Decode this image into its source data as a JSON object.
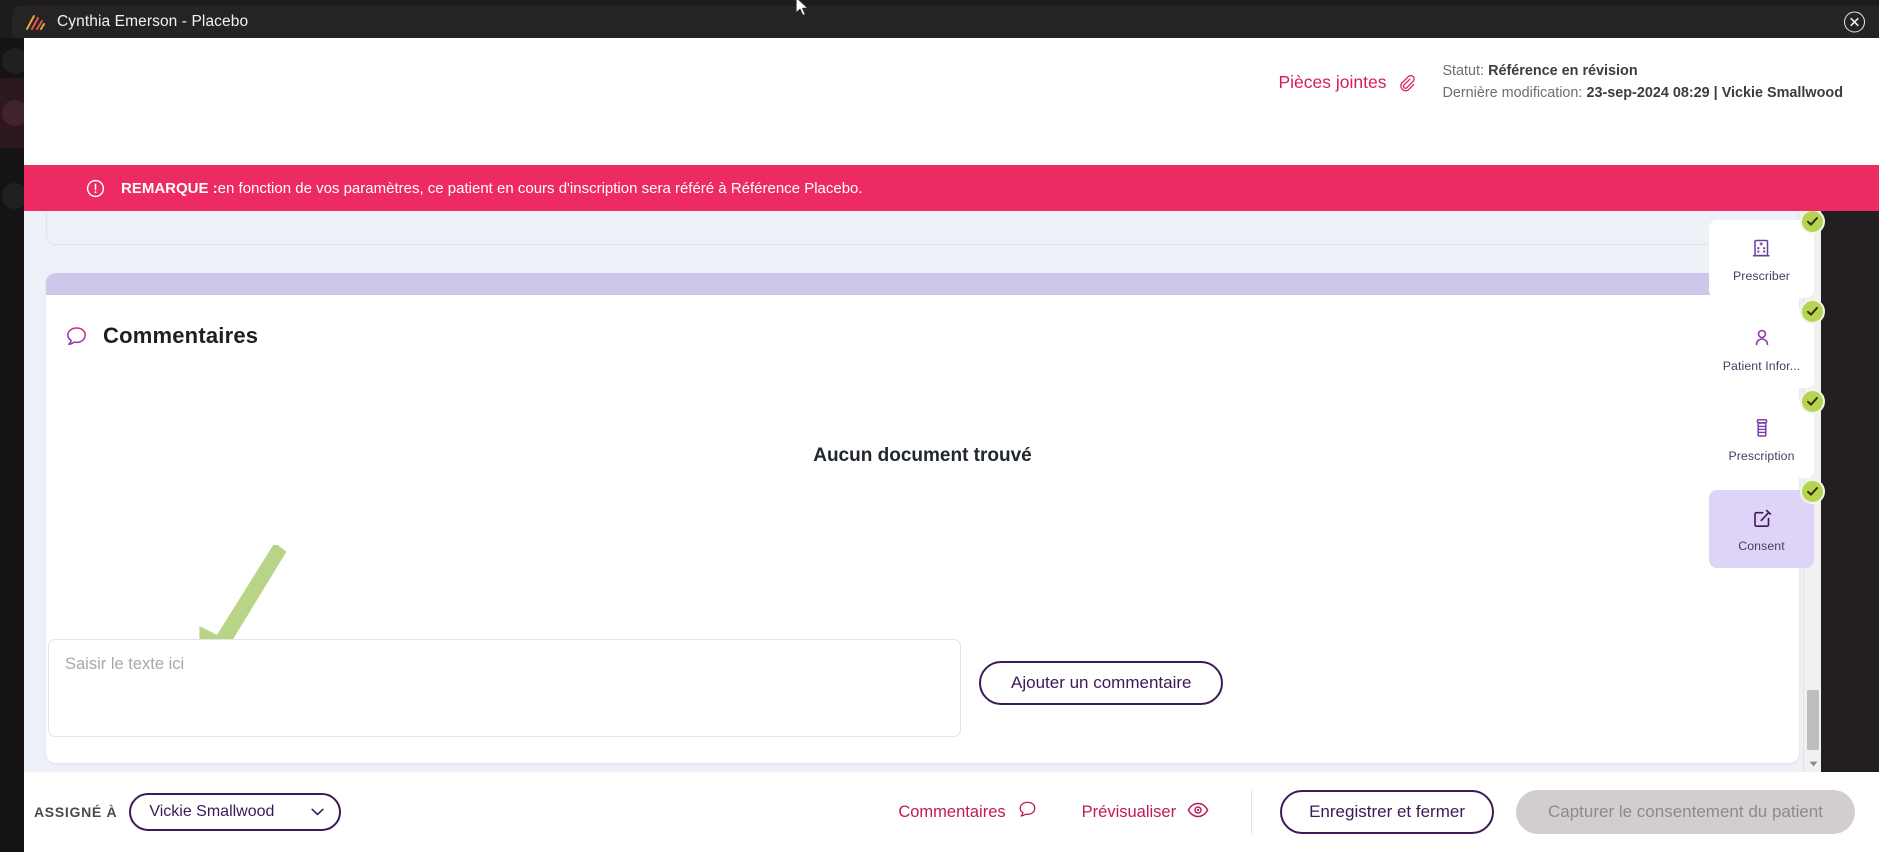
{
  "titlebar": {
    "title": "Cynthia Emerson - Placebo",
    "logo_icon": "app-logo-icon",
    "close_icon": "close-icon"
  },
  "header": {
    "attachments_label": "Pièces jointes",
    "attachments_icon": "paperclip-icon",
    "status_prefix": "Statut: ",
    "status_value": "Référence en révision",
    "modified_prefix": "Dernière modification: ",
    "modified_value": "23-sep-2024 08:29",
    "modified_separator": " | ",
    "modified_user": "Vickie Smallwood"
  },
  "banner": {
    "icon": "alert-circle-icon",
    "label": "REMARQUE : ",
    "text": "en fonction de vos paramètres, ce patient en cours d'inscription sera référé à Référence Placebo.",
    "color": "#ee2a62"
  },
  "comments": {
    "title": "Commentaires",
    "title_icon": "comment-bubble-icon",
    "empty_state": "Aucun document trouvé",
    "input_placeholder": "Saisir le texte ici",
    "input_value": "",
    "add_button": "Ajouter un commentaire"
  },
  "annotation": {
    "arrow_color": "#b7d487",
    "name": "green-arrow-annotation"
  },
  "scrollbar": {
    "up_icon": "caret-up-icon",
    "down_icon": "caret-down-icon"
  },
  "steps": [
    {
      "label": "Prescriber",
      "icon": "hospital-icon",
      "checked": true,
      "active": false
    },
    {
      "label": "Patient Infor...",
      "icon": "person-icon",
      "checked": true,
      "active": false
    },
    {
      "label": "Prescription",
      "icon": "pill-bottle-icon",
      "checked": true,
      "active": false
    },
    {
      "label": "Consent",
      "icon": "edit-square-icon",
      "checked": true,
      "active": true
    }
  ],
  "bottom_bar": {
    "assignee_label": "ASSIGNÉ À",
    "assignee_value": "Vickie  Smallwood",
    "assignee_caret_icon": "chevron-down-icon",
    "comments_link": "Commentaires",
    "comments_link_icon": "comment-bubble-icon",
    "preview_link": "Prévisualiser",
    "preview_link_icon": "eye-icon",
    "save_close_button": "Enregistrer et fermer",
    "capture_consent_button": "Capturer le consentement du patient"
  },
  "colors": {
    "accent_pink": "#d81b60",
    "accent_purple": "#3c1a57",
    "banner_pink": "#ee2a62",
    "check_green": "#b5d452",
    "lavender": "#cdc8ea",
    "active_card": "#ddd4f7"
  }
}
